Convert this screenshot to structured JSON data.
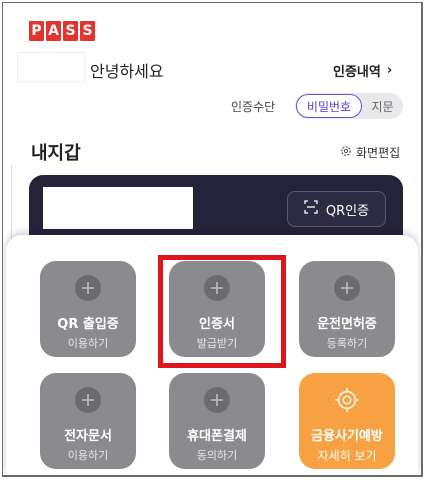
{
  "header": {
    "logo_letters": [
      "P",
      "A",
      "S",
      "S"
    ],
    "greeting": "안녕하세요",
    "history_link": "인증내역",
    "history_chevron": "›"
  },
  "auth": {
    "label": "인증수단",
    "options": [
      "비밀번호",
      "지문"
    ],
    "selected": "비밀번호"
  },
  "wallet": {
    "title": "내지갑",
    "edit_label": "화면편집",
    "qr_button": "QR인증"
  },
  "tiles": [
    {
      "label": "QR 출입증",
      "sub": "이용하기",
      "icon": "plus-icon"
    },
    {
      "label": "인증서",
      "sub": "발급받기",
      "icon": "plus-icon"
    },
    {
      "label": "운전면허증",
      "sub": "등록하기",
      "icon": "plus-icon"
    },
    {
      "label": "전자문서",
      "sub": "이용하기",
      "icon": "plus-icon"
    },
    {
      "label": "휴대폰결제",
      "sub": "동의하기",
      "icon": "plus-icon"
    },
    {
      "label": "금융사기예방",
      "sub": "자세히 보기",
      "icon": "target-icon"
    }
  ],
  "colors": {
    "brand": "#e3342f",
    "card_bg": "#25233a",
    "tile_gray": "#8b8b8f",
    "tile_orange": "#f7a142",
    "highlight": "#e0151b",
    "toggle_accent": "#5b3fd0"
  }
}
